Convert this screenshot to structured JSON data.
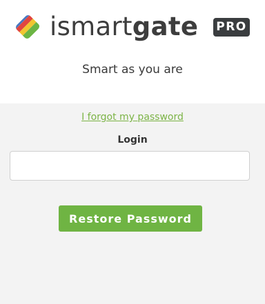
{
  "brand": {
    "name_part1": "ismart",
    "name_part2": "gate",
    "badge": "PRO",
    "tagline": "Smart as you are",
    "logo_icon": "striped-diamond-logo-icon",
    "logo_colors": [
      "#4a78c0",
      "#e2463f",
      "#f2c530",
      "#6cb544"
    ]
  },
  "form": {
    "forgot_link": "I forgot my password",
    "login_label": "Login",
    "login_value": "",
    "restore_button": "Restore Password"
  },
  "colors": {
    "accent": "#6fb443",
    "link": "#7cb446",
    "badge_bg": "#3a3d3f",
    "panel_bg": "#f3f3f3"
  }
}
